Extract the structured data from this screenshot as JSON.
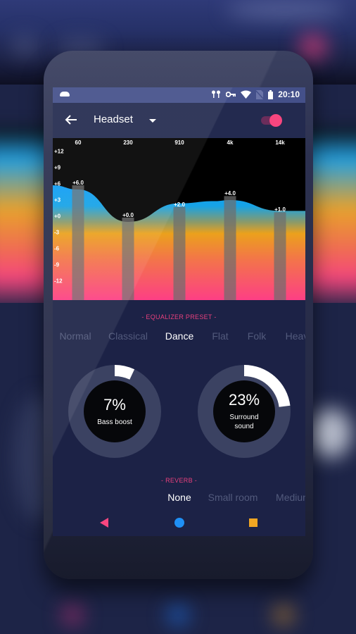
{
  "status_bar": {
    "left_icon": "cloud-icon",
    "icons": [
      "earbuds-icon",
      "vpn-key-icon",
      "wifi-icon",
      "no-sim-icon",
      "battery-icon"
    ],
    "time": "20:10"
  },
  "toolbar": {
    "back_icon": "arrow-left-icon",
    "title": "Headset",
    "dropdown_icon": "caret-down-icon",
    "toggle_on": true
  },
  "colors": {
    "accent_pink": "#f7467f",
    "accent_blue": "#1f90f5",
    "accent_orange": "#f0a623",
    "screen_bg": "#1c2246",
    "status_bar_bg": "#44508a"
  },
  "equalizer": {
    "frequencies": [
      "60",
      "230",
      "910",
      "4k",
      "14k"
    ],
    "gain_ticks": [
      "+12",
      "+9",
      "+6",
      "+3",
      "+0",
      "-3",
      "-6",
      "-9",
      "-12"
    ],
    "bands": [
      {
        "freq": "60",
        "gain": 6.0,
        "label": "+6.0"
      },
      {
        "freq": "230",
        "gain": 0.0,
        "label": "+0.0"
      },
      {
        "freq": "910",
        "gain": 2.0,
        "label": "+2.0"
      },
      {
        "freq": "4k",
        "gain": 4.0,
        "label": "+4.0"
      },
      {
        "freq": "14k",
        "gain": 1.0,
        "label": "+1.0"
      }
    ],
    "range": [
      -15,
      15
    ]
  },
  "preset": {
    "section_label": "- EQUALIZER PRESET -",
    "options": [
      "Normal",
      "Classical",
      "Dance",
      "Flat",
      "Folk",
      "Heav"
    ],
    "selected": "Dance"
  },
  "knobs": [
    {
      "value_label": "7%",
      "value": 7,
      "label_lines": [
        "Bass boost"
      ]
    },
    {
      "value_label": "23%",
      "value": 23,
      "label_lines": [
        "Surround",
        "sound"
      ]
    }
  ],
  "reverb": {
    "section_label": "- REVERB -",
    "options": [
      "None",
      "Small room",
      "Mediun"
    ],
    "selected": "None"
  },
  "navbar": {
    "back": "nav-back-icon",
    "home": "nav-home-icon",
    "recents": "nav-recents-icon"
  }
}
